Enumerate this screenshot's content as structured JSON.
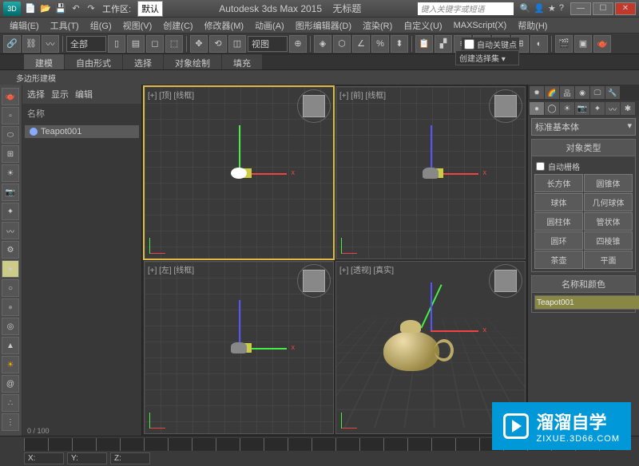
{
  "titlebar": {
    "logo": "3D",
    "workspace_label": "工作区: ",
    "workspace_value": "默认",
    "app": "Autodesk 3ds Max 2015",
    "doc": "无标题",
    "search_placeholder": "键入关键字或短语"
  },
  "menus": [
    "编辑(E)",
    "工具(T)",
    "组(G)",
    "视图(V)",
    "创建(C)",
    "修改器(M)",
    "动画(A)",
    "图形编辑器(D)",
    "渲染(R)",
    "自定义(U)",
    "MAXScript(X)",
    "帮助(H)"
  ],
  "toolbar": {
    "filter": "全部",
    "view_btn": "视图",
    "autokey": "自动关键点",
    "create_sel": "创建选择集"
  },
  "ribbon": {
    "tabs": [
      "建模",
      "自由形式",
      "选择",
      "对象绘制",
      "填充"
    ],
    "sub": "多边形建模"
  },
  "scene": {
    "cols": [
      "选择",
      "显示",
      "编辑"
    ],
    "name_hdr": "名称",
    "items": [
      "Teapot001"
    ]
  },
  "viewports": {
    "v1": "[+] [顶] [线框]",
    "v2": "[+] [前] [线框]",
    "v3": "[+] [左] [线框]",
    "v4": "[+] [透视] [真实]"
  },
  "command": {
    "category": "标准基本体",
    "rollout1": "对象类型",
    "autogrid": "自动栅格",
    "primitives": [
      "长方体",
      "圆锥体",
      "球体",
      "几何球体",
      "圆柱体",
      "管状体",
      "圆环",
      "四棱锥",
      "茶壶",
      "平面"
    ],
    "rollout2": "名称和颜色",
    "obj_name": "Teapot001"
  },
  "status": {
    "frame": "0 / 100"
  },
  "watermark": {
    "cn": "溜溜自学",
    "url": "ZIXUE.3D66.COM"
  }
}
